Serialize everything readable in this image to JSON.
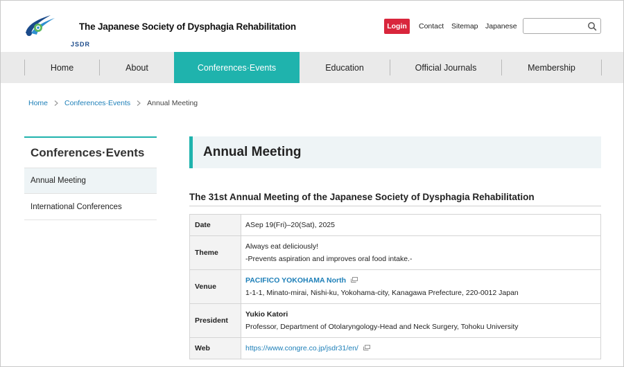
{
  "header": {
    "logo_text": "JSDR",
    "site_title": "The Japanese Society of Dysphagia Rehabilitation",
    "login_label": "Login",
    "links": [
      "Contact",
      "Sitemap",
      "Japanese"
    ],
    "search": {
      "value": "",
      "placeholder": ""
    }
  },
  "nav": {
    "items": [
      "Home",
      "About",
      "Conferences·Events",
      "Education",
      "Official Journals",
      "Membership"
    ],
    "active_index": 2
  },
  "breadcrumb": [
    "Home",
    "Conferences·Events",
    "Annual Meeting"
  ],
  "sidebar": {
    "title": "Conferences·Events",
    "items": [
      "Annual Meeting",
      "International Conferences"
    ],
    "active_index": 0
  },
  "main": {
    "heading": "Annual Meeting",
    "subheading": "The 31st Annual Meeting of the Japanese Society of Dysphagia Rehabilitation",
    "table": {
      "date": {
        "label": "Date",
        "value": "ASep 19(Fri)–20(Sat), 2025"
      },
      "theme": {
        "label": "Theme",
        "line1": "Always eat deliciously!",
        "line2": "-Prevents aspiration and improves oral food intake.-"
      },
      "venue": {
        "label": "Venue",
        "name": "PACIFICO YOKOHAMA North",
        "address": "1-1-1, Minato-mirai, Nishi-ku, Yokohama-city, Kanagawa Prefecture, 220-0012 Japan"
      },
      "president": {
        "label": "President",
        "name": "Yukio Katori",
        "affiliation": "Professor, Department of Otolaryngology-Head and Neck Surgery, Tohoku University"
      },
      "web": {
        "label": "Web",
        "url": "https://www.congre.co.jp/jsdr31/en/"
      }
    }
  },
  "colors": {
    "accent": "#1fb3ad",
    "login": "#d9263c",
    "link": "#1d7fb8",
    "panel": "#eef4f6"
  }
}
